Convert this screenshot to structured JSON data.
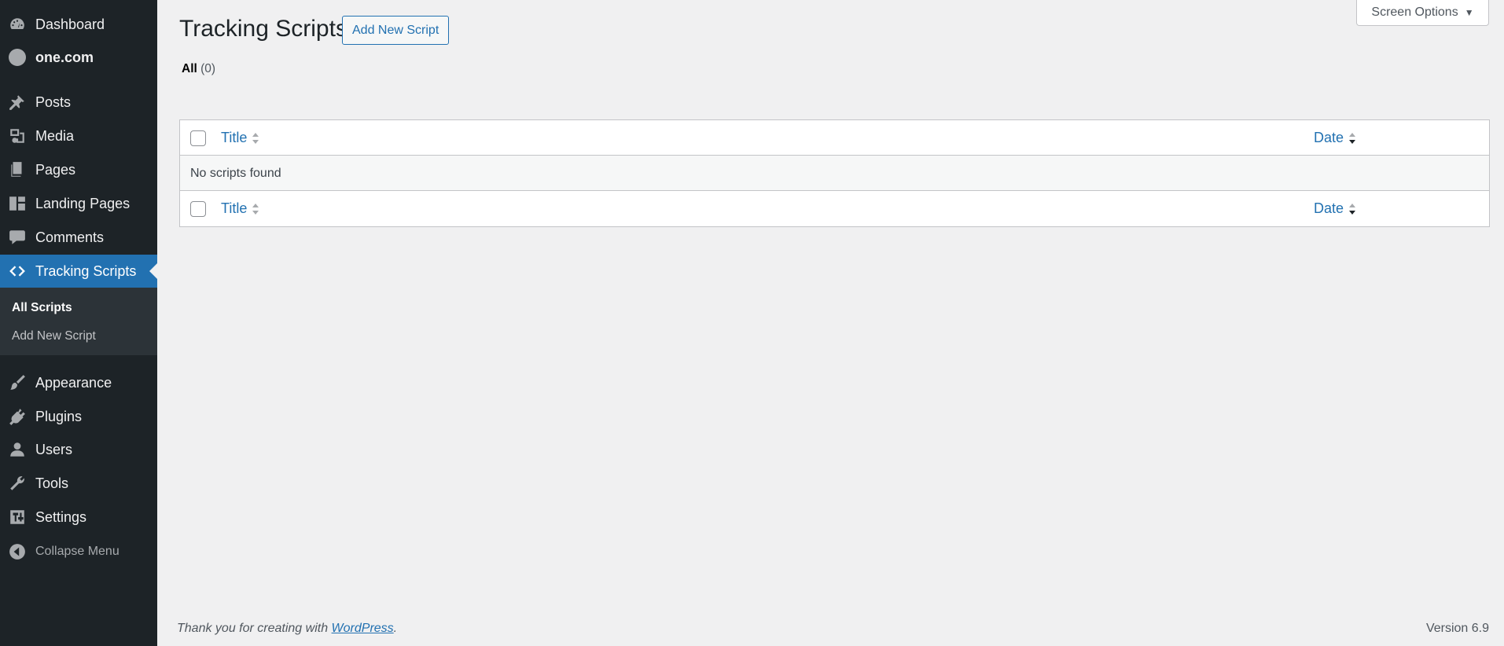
{
  "sidebar": {
    "items": [
      {
        "label": "Dashboard",
        "icon": "dashboard-icon"
      },
      {
        "label": "one.com",
        "icon": "onecom-icon"
      },
      {
        "label": "Posts",
        "icon": "pushpin-icon"
      },
      {
        "label": "Media",
        "icon": "media-icon"
      },
      {
        "label": "Pages",
        "icon": "pages-icon"
      },
      {
        "label": "Landing Pages",
        "icon": "landing-pages-icon"
      },
      {
        "label": "Comments",
        "icon": "comment-icon"
      },
      {
        "label": "Tracking Scripts",
        "icon": "code-icon"
      },
      {
        "label": "Appearance",
        "icon": "brush-icon"
      },
      {
        "label": "Plugins",
        "icon": "plugin-icon"
      },
      {
        "label": "Users",
        "icon": "user-icon"
      },
      {
        "label": "Tools",
        "icon": "wrench-icon"
      },
      {
        "label": "Settings",
        "icon": "settings-icon"
      },
      {
        "label": "Collapse Menu",
        "icon": "collapse-icon"
      }
    ],
    "submenu": {
      "all_scripts": "All Scripts",
      "add_new_script": "Add New Script"
    }
  },
  "header": {
    "title": "Tracking Scripts",
    "add_new_label": "Add New Script",
    "screen_options_label": "Screen Options"
  },
  "filters": {
    "all_label": "All",
    "all_count": "(0)"
  },
  "table": {
    "columns": {
      "title": "Title",
      "date": "Date"
    },
    "empty_message": "No scripts found"
  },
  "footer": {
    "thanks_prefix": "Thank you for creating with ",
    "thanks_link": "WordPress",
    "thanks_suffix": ".",
    "version": "Version 6.9"
  },
  "colors": {
    "sidebar_bg": "#1d2327",
    "active_bg": "#2271b1",
    "link": "#2271b1",
    "page_bg": "#f0f0f1"
  }
}
